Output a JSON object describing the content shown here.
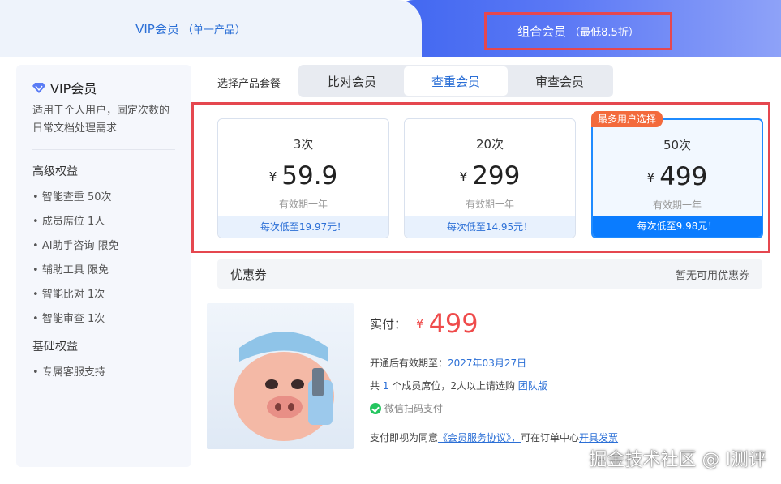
{
  "tabs": {
    "vip_label": "VIP会员",
    "vip_sub": "（单一产品）",
    "combo_label": "组合会员",
    "combo_sub": "（最低8.5折）"
  },
  "sidebar": {
    "title": "VIP会员",
    "desc": "适用于个人用户，固定次数的日常文档处理需求",
    "section_advanced": "高级权益",
    "advanced_items": [
      "智能查重 50次",
      "成员席位 1人",
      "AI助手咨询 限免",
      "辅助工具 限免",
      "智能比对 1次",
      "智能审查 1次"
    ],
    "section_basic": "基础权益",
    "basic_items": [
      "专属客服支持"
    ]
  },
  "selector": {
    "label": "选择产品套餐",
    "options": [
      "比对会员",
      "查重会员",
      "审查会员"
    ],
    "selected": "查重会员"
  },
  "plans": [
    {
      "count": "3次",
      "currency": "¥",
      "price": "59.9",
      "validity": "有效期一年",
      "per_use": "每次低至19.97元！"
    },
    {
      "count": "20次",
      "currency": "¥",
      "price": "299",
      "validity": "有效期一年",
      "per_use": "每次低至14.95元！"
    },
    {
      "count": "50次",
      "currency": "¥",
      "price": "499",
      "validity": "有效期一年",
      "per_use": "每次低至9.98元！"
    }
  ],
  "badge": "最多用户选择",
  "coupon": {
    "label": "优惠券",
    "value": "暂无可用优惠券"
  },
  "payment": {
    "label": "实付：",
    "currency": "¥",
    "amount": "499",
    "expire_label": "开通后有效期至：",
    "expire_date": "2027年03月27日",
    "seat_prefix": "共",
    "seat_count": "1",
    "seat_suffix": "个成员席位，2人以上请选购",
    "team_link": "团队版",
    "wechat": "微信扫码支付",
    "agree_prefix": "支付即视为同意",
    "agreement": "《会员服务协议》，",
    "agree_mid": "可在订单中心",
    "invoice": "开具发票"
  },
  "watermark": "掘金技术社区 @ I测评",
  "colors": {
    "accent": "#2b6fd6",
    "price_red": "#ef4b4b",
    "highlight_border": "#e5474f",
    "badge": "#f36a3c"
  }
}
